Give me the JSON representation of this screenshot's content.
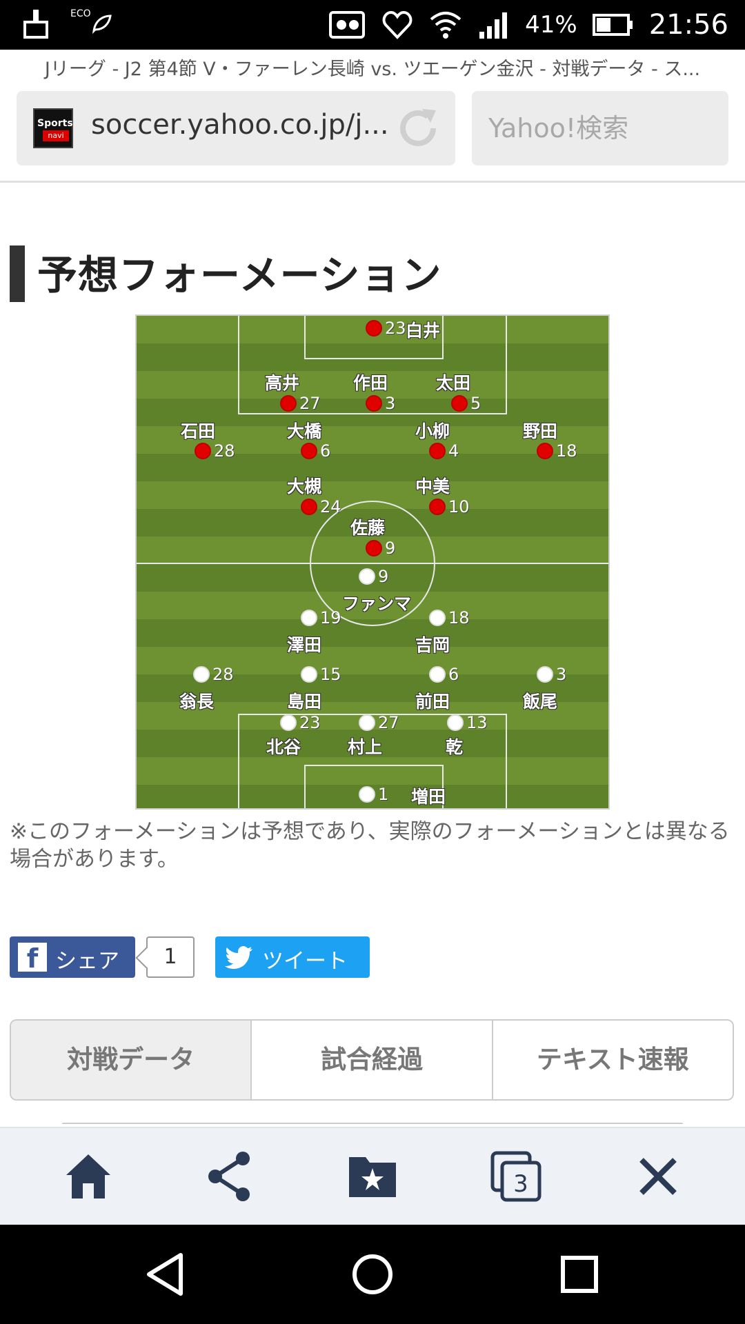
{
  "status_bar": {
    "eco_label": "ECO",
    "battery_percent": "41%",
    "time": "21:56"
  },
  "browser": {
    "page_title": "Jリーグ - J2 第4節 V・ファーレン長崎 vs. ツエーゲン金沢 - 対戦データ - ス...",
    "favicon_text_top": "Sports",
    "favicon_text_bottom": "navi",
    "url": "soccer.yahoo.co.jp/j...",
    "search_placeholder": "Yahoo!検索"
  },
  "section": {
    "title": "予想フォーメーション"
  },
  "formation": {
    "home_team_color": "#e00000",
    "away_team_color": "#ffffff",
    "red_players": [
      {
        "name": "白井",
        "number": "23"
      },
      {
        "name": "高井",
        "number": "27"
      },
      {
        "name": "作田",
        "number": "3"
      },
      {
        "name": "太田",
        "number": "5"
      },
      {
        "name": "石田",
        "number": "28"
      },
      {
        "name": "大橋",
        "number": "6"
      },
      {
        "name": "小柳",
        "number": "4"
      },
      {
        "name": "野田",
        "number": "18"
      },
      {
        "name": "大槻",
        "number": "24"
      },
      {
        "name": "中美",
        "number": "10"
      },
      {
        "name": "佐藤",
        "number": "9"
      }
    ],
    "white_players": [
      {
        "name": "ファンマ",
        "number": "9"
      },
      {
        "name": "澤田",
        "number": "19"
      },
      {
        "name": "吉岡",
        "number": "18"
      },
      {
        "name": "翁長",
        "number": "28"
      },
      {
        "name": "島田",
        "number": "15"
      },
      {
        "name": "前田",
        "number": "6"
      },
      {
        "name": "飯尾",
        "number": "3"
      },
      {
        "name": "北谷",
        "number": "23"
      },
      {
        "name": "村上",
        "number": "27"
      },
      {
        "name": "乾",
        "number": "13"
      },
      {
        "name": "増田",
        "number": "1"
      }
    ]
  },
  "note": "※このフォーメーションは予想であり、実際のフォーメーションとは異なる場合があります。",
  "share": {
    "facebook_label": "シェア",
    "facebook_count": "1",
    "twitter_label": "ツイート"
  },
  "tabs": [
    {
      "label": "対戦データ",
      "active": true
    },
    {
      "label": "試合経過",
      "active": false
    },
    {
      "label": "テキスト速報",
      "active": false
    }
  ],
  "toolbar": {
    "tabs_count": "3",
    "icons": [
      "home-icon",
      "share-icon",
      "bookmarks-icon",
      "tabs-icon",
      "close-icon"
    ],
    "icon_color": "#2b3a55"
  },
  "nav": {
    "icons": [
      "back-icon",
      "home-circle-icon",
      "recents-icon"
    ]
  }
}
